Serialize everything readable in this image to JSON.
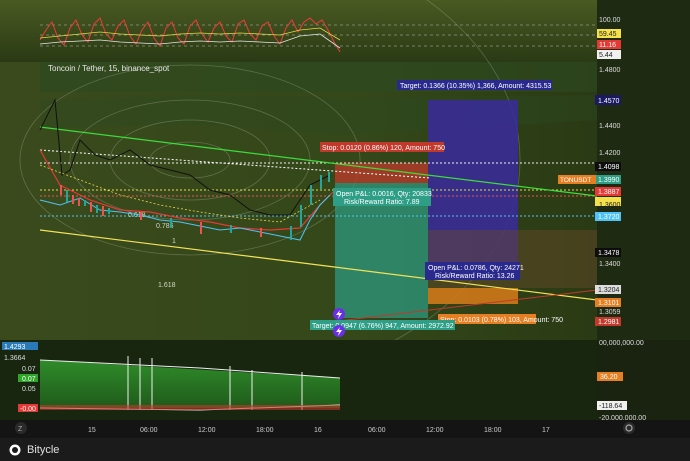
{
  "app": {
    "name": "Bitycle"
  },
  "chart": {
    "title": "Toncoin / Tether, 15, binance_spot",
    "oscillator_scale": [
      "100.00",
      "59.45",
      "11.16",
      "5.44"
    ],
    "price_scale": [
      "1.4800",
      "1.4570",
      "1.4400",
      "1.4200",
      "1.4098",
      "1.3990",
      "1.3887",
      "1.3720",
      "1.3600",
      "1.3478",
      "1.3400",
      "1.3204",
      "1.3101",
      "1.3059",
      "1.2981"
    ],
    "symbol_tag": "TONUSDT",
    "volume_scale": [
      "1.4293",
      "1.3664",
      "0.07",
      "0.07",
      "0.05",
      "-0.00",
      "36.20",
      "-118.64",
      "-20,000,000.00",
      "00,000,000.00"
    ],
    "time_axis": [
      "15",
      "06:00",
      "12:00",
      "18:00",
      "16",
      "06:00",
      "12:00",
      "18:00",
      "17"
    ],
    "fib_labels": [
      "0.618",
      "0.786",
      "1",
      "1.618"
    ],
    "short_trade": {
      "target_label": "Target: 0.1366 (10.35%) 1,366, Amount: 4315.53",
      "stop_label": "Stop: 0.0103 (0.78%) 103, Amount: 750",
      "pnl_label": "Open P&L: 0.0786, Qty: 24271",
      "rr_label": "Risk/Reward Ratio: 13.26"
    },
    "long_trade": {
      "stop_label": "Stop: 0.0120 (0.86%) 120, Amount: 750",
      "target_label": "Target: 0.0947 (6.76%) 947, Amount: 2972.92",
      "pnl_label": "Open P&L: 0.0016, Qty: 20833",
      "rr_label": "Risk/Reward Ratio: 7.89"
    },
    "colors": {
      "up": "#26a69a",
      "down": "#ef5350",
      "profit_zone": "#2e9e86",
      "short_target_zone": "#3a2a9e",
      "stop_zone": "#c0392b",
      "orange": "#f39c12",
      "green_band": "#3e7d2a"
    },
    "scroll_marker": "Z",
    "settings_icon": "gear-icon"
  }
}
